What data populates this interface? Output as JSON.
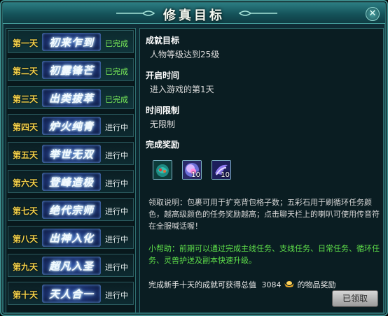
{
  "window": {
    "title": "修真目标"
  },
  "days": [
    {
      "num": "第一天",
      "title": "初来乍到",
      "status": "已完成",
      "done": true
    },
    {
      "num": "第二天",
      "title": "初露锋芒",
      "status": "已完成",
      "done": true
    },
    {
      "num": "第三天",
      "title": "出类拔萃",
      "status": "已完成",
      "done": true
    },
    {
      "num": "第四天",
      "title": "炉火纯青",
      "status": "进行中",
      "done": false
    },
    {
      "num": "第五天",
      "title": "举世无双",
      "status": "进行中",
      "done": false
    },
    {
      "num": "第六天",
      "title": "登峰造极",
      "status": "进行中",
      "done": false
    },
    {
      "num": "第七天",
      "title": "绝代宗师",
      "status": "进行中",
      "done": false
    },
    {
      "num": "第八天",
      "title": "出神入化",
      "status": "进行中",
      "done": false
    },
    {
      "num": "第九天",
      "title": "超凡入圣",
      "status": "进行中",
      "done": false
    },
    {
      "num": "第十天",
      "title": "天人合一",
      "status": "进行中",
      "done": false
    }
  ],
  "detail": {
    "goal_label": "成就目标",
    "goal_text": "人物等级达到25级",
    "start_label": "开启时间",
    "start_text": "进入游戏的第1天",
    "limit_label": "时间限制",
    "limit_text": "无限制",
    "reward_label": "完成奖励",
    "rewards": [
      {
        "icon": "treasure-chest-icon",
        "count": ""
      },
      {
        "icon": "five-color-stone-icon",
        "count": "10"
      },
      {
        "icon": "horn-icon",
        "count": "10"
      }
    ],
    "desc": "领取说明：包裹可用于扩充背包格子数；五彩石用于刷循环任务颜色，越高级颜色的任务奖励越高；点击聊天栏上的喇叭可使用传音符在全服喊话喔！",
    "tip": "小帮助：前期可以通过完成主线任务、支线任务、日常任务、循环任务、灵兽护送及副本快速升级。",
    "footer_prefix": "完成新手十天的成就可获得总值",
    "footer_value": "3084",
    "footer_suffix": "的物品奖励",
    "claim_button": "已领取"
  },
  "colors": {
    "done_status": "#7cf05a",
    "day_num": "#f5d24a",
    "tip": "#5fe04a"
  }
}
